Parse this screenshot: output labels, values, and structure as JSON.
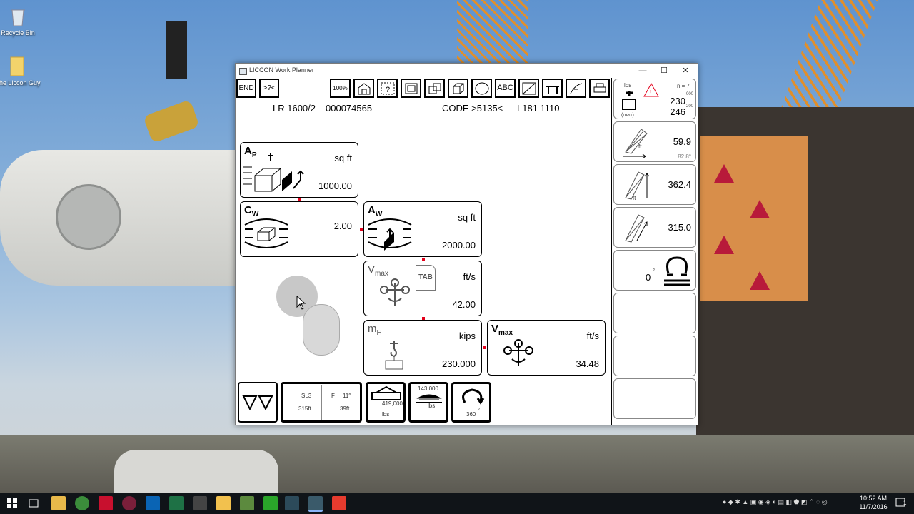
{
  "desktop": {
    "icons": [
      {
        "label": "Recycle Bin",
        "icon": "recycle-bin-icon"
      },
      {
        "label": "The Liccon Guy",
        "icon": "folder-icon"
      }
    ]
  },
  "window": {
    "title": "LICCON Work Planner",
    "controls": {
      "minimize": "—",
      "maximize": "☐",
      "close": "✕"
    }
  },
  "toolbar": {
    "end_label": "END",
    "help_label": ">?<",
    "percent_label": "100%",
    "abc_label": "ABC"
  },
  "header": {
    "model": "LR 1600/2",
    "serial": "000074565",
    "code": "CODE >5135<",
    "config": "L181 1110"
  },
  "panels": {
    "ap": {
      "symbol": "A",
      "sub": "P",
      "unit": "sq ft",
      "value": "1000.00"
    },
    "cw": {
      "symbol": "C",
      "sub": "W",
      "value": "2.00"
    },
    "aw": {
      "symbol": "A",
      "sub": "W",
      "unit": "sq ft",
      "value": "2000.00"
    },
    "vmax_tab": {
      "symbol": "V",
      "sub": "max",
      "tab": "TAB",
      "unit": "ft/s",
      "value": "42.00"
    },
    "mh": {
      "symbol": "m",
      "sub": "H",
      "unit": "kips",
      "value": "230.000"
    },
    "vmax": {
      "symbol": "V",
      "sub": "max",
      "unit": "ft/s",
      "value": "34.48"
    }
  },
  "right_panel": {
    "load": {
      "unit": "lbs",
      "n_label": "n = 7",
      "value": "230",
      "value_sup": "000",
      "max_label": "(max)",
      "max_value": "246",
      "max_sup": "200"
    },
    "radius": {
      "unit": "ft",
      "value": "59.9",
      "angle": "82.8°"
    },
    "height": {
      "unit": "ft",
      "value": "362.4"
    },
    "boom": {
      "value": "315.0"
    },
    "slew": {
      "value": "0",
      "unit": "°"
    }
  },
  "bottom_bar": {
    "config": {
      "sl": "SL3",
      "f": "F",
      "angle": "11°",
      "main_len": "315ft",
      "fly_len": "39ft"
    },
    "counterweight": {
      "value": "419,000",
      "unit": "lbs"
    },
    "ballast": {
      "value": "143,000",
      "unit": "lbs"
    },
    "slew_range": {
      "value": "360",
      "unit": "°"
    }
  },
  "taskbar": {
    "clock_time": "10:52 AM",
    "clock_date": "11/7/2016",
    "notifications": "1"
  },
  "colors": {
    "accent_red": "#e3001b",
    "taskbar": "#101418",
    "window_border": "#7a7a7a"
  }
}
